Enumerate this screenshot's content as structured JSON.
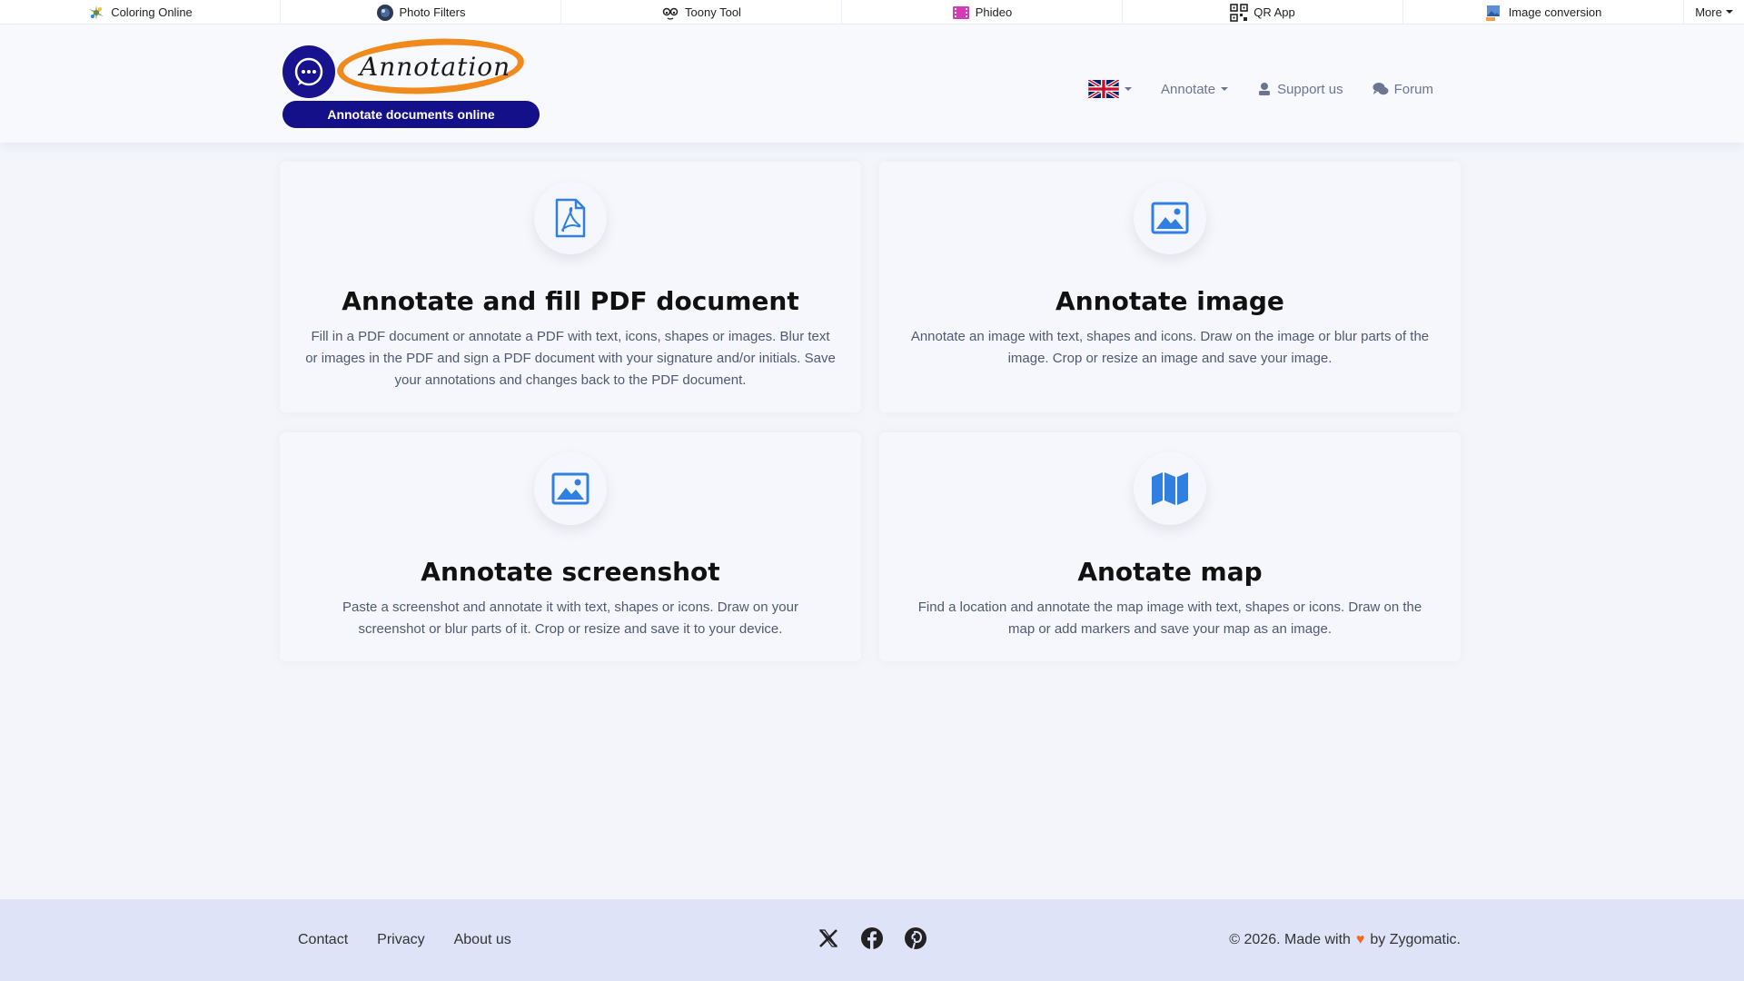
{
  "topbar": {
    "apps": [
      {
        "label": "Coloring Online",
        "icon": "coloring-icon"
      },
      {
        "label": "Photo Filters",
        "icon": "camera-lens-icon"
      },
      {
        "label": "Toony Tool",
        "icon": "toony-face-icon"
      },
      {
        "label": "Phideo",
        "icon": "film-icon"
      },
      {
        "label": "QR App",
        "icon": "qr-code-icon"
      },
      {
        "label": "Image conversion",
        "icon": "image-convert-icon"
      }
    ],
    "more_label": "More"
  },
  "header": {
    "logo_word": "Annotation",
    "tagline": "Annotate documents online",
    "nav": {
      "language_flag": "uk-flag-icon",
      "annotate_label": "Annotate",
      "support_label": "Support us",
      "forum_label": "Forum"
    }
  },
  "cards": [
    {
      "icon": "pdf-file-icon",
      "title": "Annotate and fill PDF document",
      "description": "Fill in a PDF document or annotate a PDF with text, icons, shapes or images. Blur text or images in the PDF and sign a PDF document with your signature and/or initials. Save your annotations and changes back to the PDF document."
    },
    {
      "icon": "image-icon",
      "title": "Annotate image",
      "description": "Annotate an image with text, shapes and icons. Draw on the image or blur parts of the image. Crop or resize an image and save your image."
    },
    {
      "icon": "screenshot-icon",
      "title": "Annotate screenshot",
      "description": "Paste a screenshot and annotate it with text, shapes or icons. Draw on your screenshot or blur parts of it. Crop or resize and save it to your device."
    },
    {
      "icon": "map-icon",
      "title": "Anotate map",
      "description": "Find a location and annotate the map image with text, shapes or icons. Draw on the map or add markers and save your map as an image."
    }
  ],
  "footer": {
    "links": [
      "Contact",
      "Privacy",
      "About us"
    ],
    "social": [
      "x-icon",
      "facebook-icon",
      "pinterest-icon"
    ],
    "copyright_prefix": "© 2026. Made with",
    "copyright_suffix": "by Zygomatic."
  },
  "colors": {
    "accent_blue": "#2f80e0",
    "brand_navy": "#14108a",
    "brand_orange": "#f08a1d",
    "heart": "#f06a24"
  }
}
